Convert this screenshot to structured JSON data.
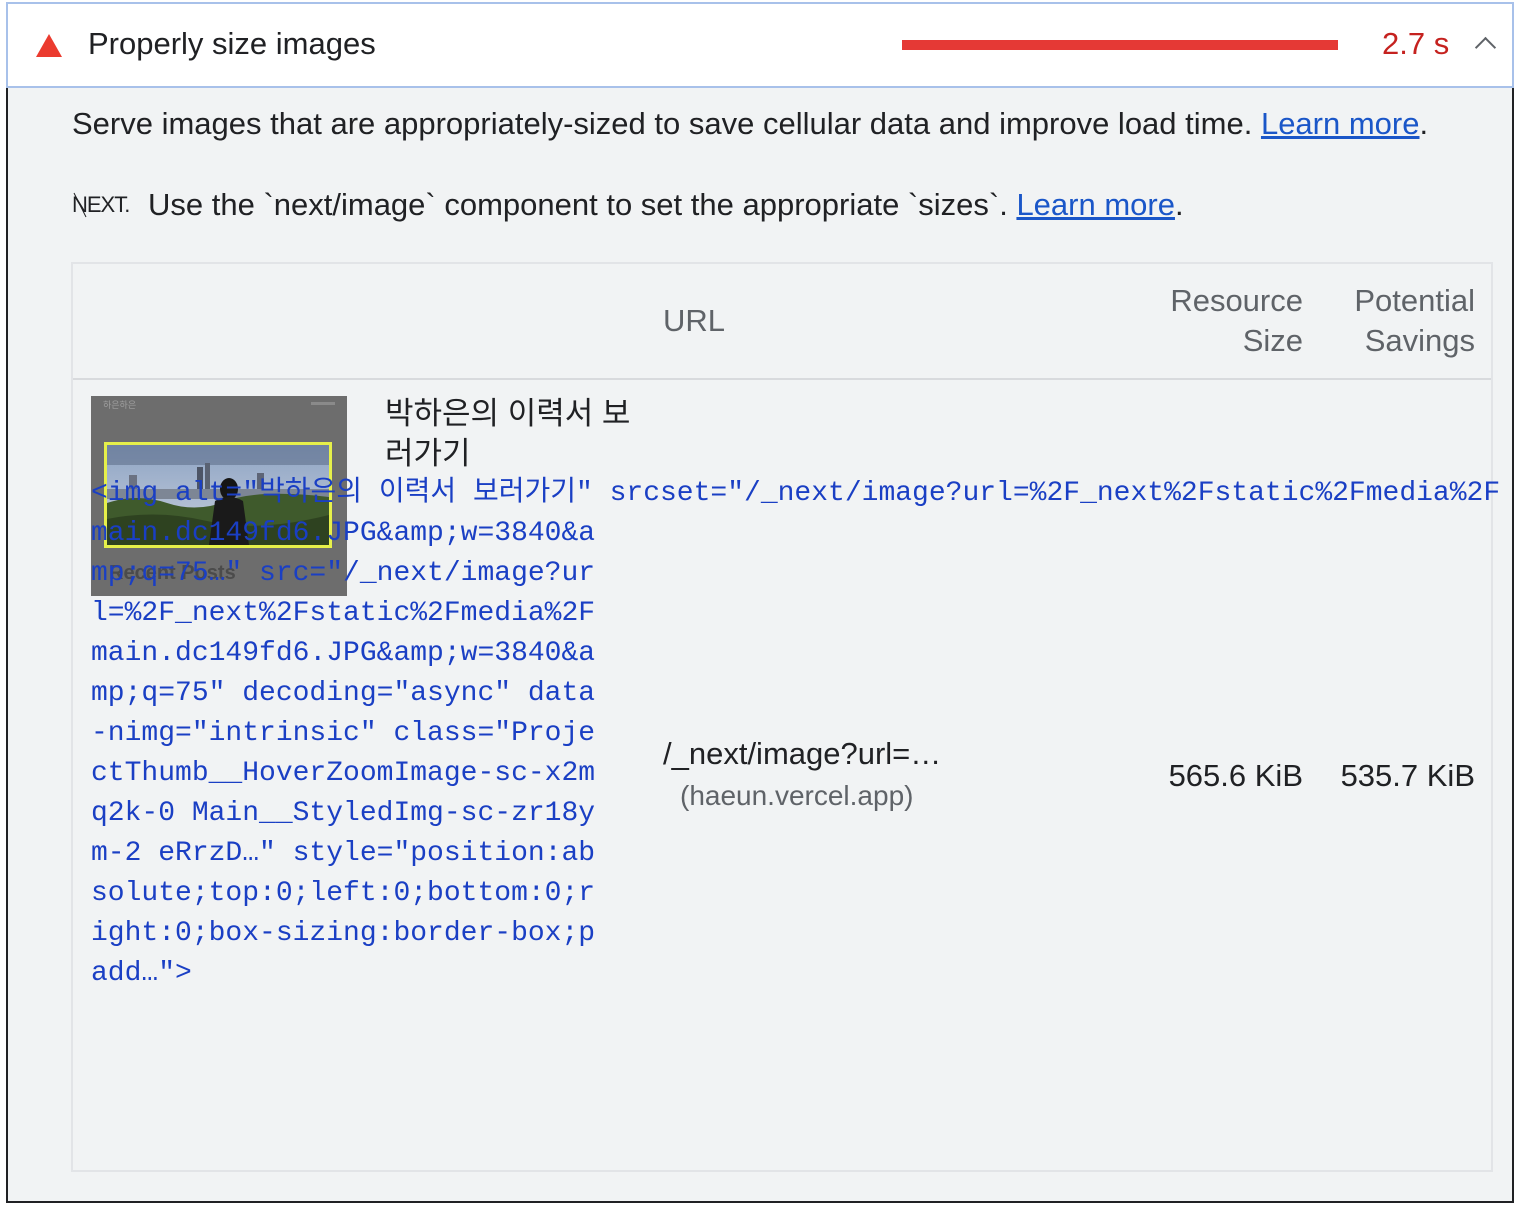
{
  "audit": {
    "title": "Properly size images",
    "metric": "2.7 s",
    "status_color": "#eb3b2f",
    "icon": "warning-triangle-icon"
  },
  "description": {
    "text": "Serve images that are appropriately-sized to save cellular data and improve load time. ",
    "link": "Learn more",
    "tail": "."
  },
  "stack_pack": {
    "logo": "NEXT.",
    "text": "Use the `next/image` component to set the appropriate `sizes`. ",
    "link": "Learn more",
    "tail": "."
  },
  "table": {
    "headers": {
      "url": "URL",
      "resource_size": "Resource\nSize",
      "potential_savings": "Potential\nSavings"
    },
    "rows": [
      {
        "thumbnail_logo": "하은하은",
        "thumbnail_label": "Recent Posts",
        "node_label": "박하은의 이력서 보러가기",
        "snippet": "<img alt=\"박하은의 이력서 보러가기\" srcset=\"/_next/image?url=%2F_next%2Fstatic%2Fmedia%2Fmain.dc149fd6.JPG&amp;w=3840&amp;q=75…\" src=\"/_next/image?url=%2F_next%2Fstatic%2Fmedia%2Fmain.dc149fd6.JPG&amp;w=3840&amp;q=75\" decoding=\"async\" data-nimg=\"intrinsic\" class=\"ProjectThumb__HoverZoomImage-sc-x2mq2k-0 Main__StyledImg-sc-zr18ym-2 eRrzD…\" style=\"position:absolute;top:0;left:0;bottom:0;right:0;box-sizing:border-box;padd…\">",
        "url": "/_next/image?url=…",
        "host": "(haeun.vercel.app)",
        "resource_size": "565.6 KiB",
        "potential_savings": "535.7 KiB"
      }
    ]
  }
}
